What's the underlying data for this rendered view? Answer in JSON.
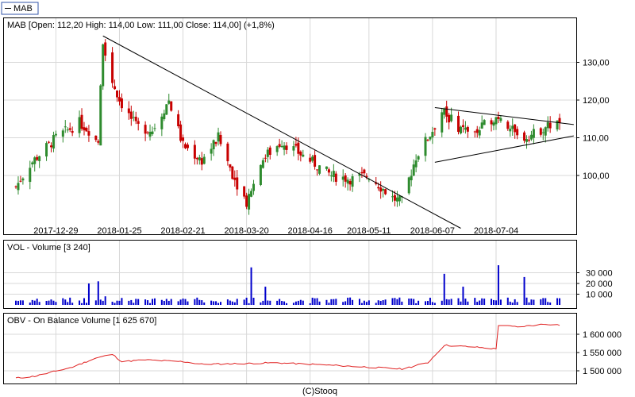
{
  "legend_tag": "MAB",
  "footer": "(C)Stooq",
  "colors": {
    "up": "#2e8b2e",
    "down": "#c80000",
    "volume": "#0000cc",
    "obv": "#e02020",
    "trend": "#000000",
    "grid": "#d8d8d8",
    "frame": "#000000"
  },
  "chart_data": [
    {
      "type": "candlestick",
      "title": "MAB [Open: 112,20  High: 114,00  Low: 111,00  Close: 114,00] (+1,8%)",
      "x_tick_labels": [
        "2017-12-29",
        "2018-01-25",
        "2018-02-21",
        "2018-03-20",
        "2018-04-16",
        "2018-05-11",
        "2018-06-07",
        "2018-07-04"
      ],
      "y_tick_labels": [
        "100,00",
        "110,00",
        "120,00",
        "130,00"
      ],
      "ylim": [
        90,
        140
      ],
      "grid": true,
      "anchors": [
        {
          "date": "2017-12-12",
          "close": 97
        },
        {
          "date": "2017-12-18",
          "close": 103
        },
        {
          "date": "2017-12-29",
          "close": 110
        },
        {
          "date": "2018-01-08",
          "close": 114
        },
        {
          "date": "2018-01-16",
          "close": 110
        },
        {
          "date": "2018-01-18",
          "close": 136
        },
        {
          "date": "2018-01-22",
          "close": 125
        },
        {
          "date": "2018-01-25",
          "close": 120
        },
        {
          "date": "2018-02-01",
          "close": 113
        },
        {
          "date": "2018-02-08",
          "close": 112
        },
        {
          "date": "2018-02-15",
          "close": 120
        },
        {
          "date": "2018-02-21",
          "close": 108
        },
        {
          "date": "2018-03-01",
          "close": 104
        },
        {
          "date": "2018-03-08",
          "close": 110
        },
        {
          "date": "2018-03-15",
          "close": 99
        },
        {
          "date": "2018-03-20",
          "close": 93
        },
        {
          "date": "2018-03-26",
          "close": 104
        },
        {
          "date": "2018-04-04",
          "close": 109
        },
        {
          "date": "2018-04-16",
          "close": 104
        },
        {
          "date": "2018-04-25",
          "close": 100
        },
        {
          "date": "2018-05-04",
          "close": 99
        },
        {
          "date": "2018-05-11",
          "close": 100
        },
        {
          "date": "2018-05-21",
          "close": 94
        },
        {
          "date": "2018-05-25",
          "close": 93
        },
        {
          "date": "2018-05-31",
          "close": 105
        },
        {
          "date": "2018-06-07",
          "close": 112
        },
        {
          "date": "2018-06-11",
          "close": 117
        },
        {
          "date": "2018-06-18",
          "close": 113
        },
        {
          "date": "2018-06-25",
          "close": 111
        },
        {
          "date": "2018-07-02",
          "close": 115
        },
        {
          "date": "2018-07-06",
          "close": 116
        },
        {
          "date": "2018-07-13",
          "close": 110
        },
        {
          "date": "2018-07-20",
          "close": 111
        },
        {
          "date": "2018-07-25",
          "close": 113
        },
        {
          "date": "2018-07-31",
          "close": 114
        }
      ],
      "trendlines": [
        {
          "from": {
            "date": "2018-01-18",
            "value": 137
          },
          "to": {
            "date": "2018-06-19",
            "value": 86
          }
        },
        {
          "from": {
            "date": "2018-06-08",
            "value": 118
          },
          "to": {
            "date": "2018-08-06",
            "value": 113.5
          }
        },
        {
          "from": {
            "date": "2018-06-08",
            "value": 103.5
          },
          "to": {
            "date": "2018-08-06",
            "value": 110.5
          }
        }
      ]
    },
    {
      "type": "bar",
      "title": "VOL - Volume [3 240]",
      "y_tick_labels": [
        "10 000",
        "20 000",
        "30 000"
      ],
      "ylim": [
        0,
        40000
      ],
      "spikes": [
        {
          "date": "2018-01-12",
          "value": 20000
        },
        {
          "date": "2018-01-16",
          "value": 22000
        },
        {
          "date": "2018-01-19",
          "value": 8000
        },
        {
          "date": "2018-03-22",
          "value": 35000
        },
        {
          "date": "2018-03-28",
          "value": 17000
        },
        {
          "date": "2018-06-12",
          "value": 29000
        },
        {
          "date": "2018-07-05",
          "value": 37000
        },
        {
          "date": "2018-07-16",
          "value": 26000
        },
        {
          "date": "2018-06-20",
          "value": 17000
        }
      ],
      "last_value": 3240
    },
    {
      "type": "line",
      "title": "OBV - On Balance Volume [1 625 670]",
      "y_tick_labels": [
        "1 500 000",
        "1 550 000",
        "1 600 000"
      ],
      "ylim": [
        1480000,
        1640000
      ],
      "points": [
        {
          "date": "2017-12-12",
          "value": 1480000
        },
        {
          "date": "2017-12-20",
          "value": 1485000
        },
        {
          "date": "2018-01-05",
          "value": 1510000
        },
        {
          "date": "2018-01-15",
          "value": 1535000
        },
        {
          "date": "2018-01-22",
          "value": 1545000
        },
        {
          "date": "2018-01-26",
          "value": 1525000
        },
        {
          "date": "2018-02-05",
          "value": 1530000
        },
        {
          "date": "2018-02-21",
          "value": 1525000
        },
        {
          "date": "2018-03-01",
          "value": 1518000
        },
        {
          "date": "2018-03-20",
          "value": 1520000
        },
        {
          "date": "2018-04-01",
          "value": 1522000
        },
        {
          "date": "2018-04-16",
          "value": 1518000
        },
        {
          "date": "2018-05-11",
          "value": 1510000
        },
        {
          "date": "2018-05-25",
          "value": 1505000
        },
        {
          "date": "2018-06-05",
          "value": 1522000
        },
        {
          "date": "2018-06-12",
          "value": 1570000
        },
        {
          "date": "2018-06-25",
          "value": 1565000
        },
        {
          "date": "2018-07-04",
          "value": 1560000
        },
        {
          "date": "2018-07-05",
          "value": 1625000
        },
        {
          "date": "2018-07-13",
          "value": 1620000
        },
        {
          "date": "2018-07-25",
          "value": 1628000
        },
        {
          "date": "2018-07-31",
          "value": 1625670
        }
      ]
    }
  ]
}
